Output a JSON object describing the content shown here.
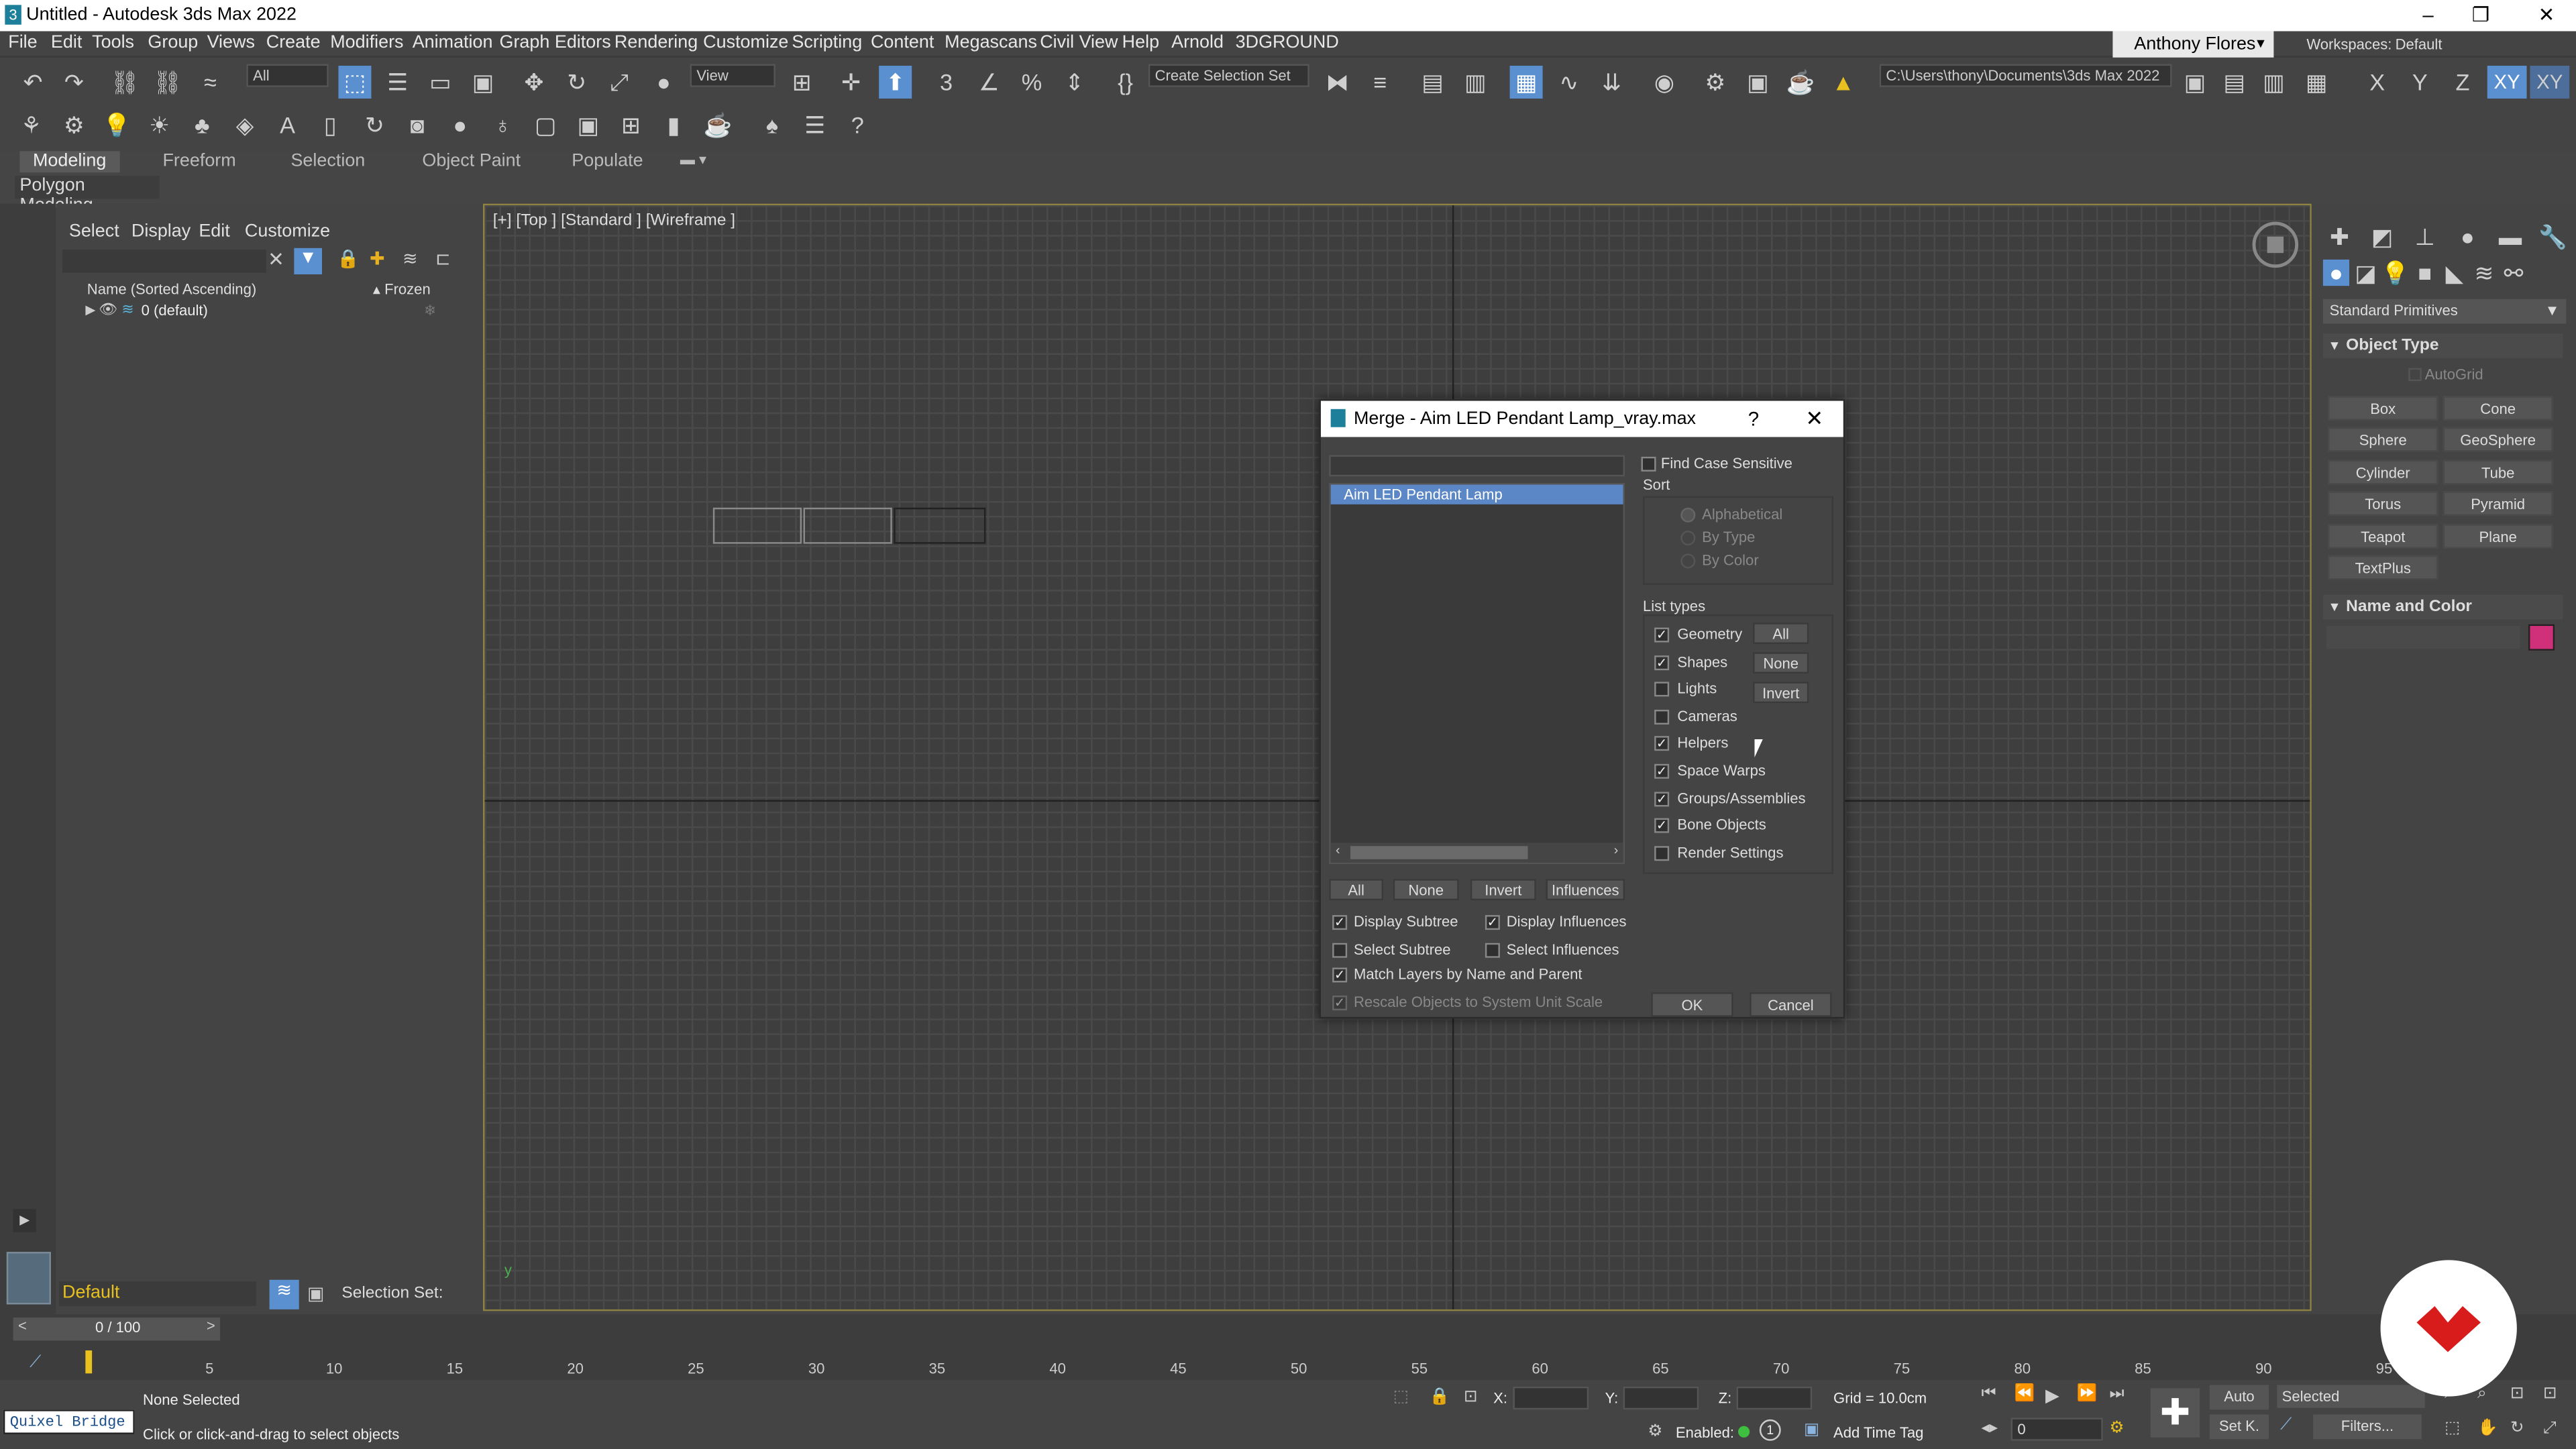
{
  "window": {
    "title": "Untitled - Autodesk 3ds Max 2022"
  },
  "menu": [
    "File",
    "Edit",
    "Tools",
    "Group",
    "Views",
    "Create",
    "Modifiers",
    "Animation",
    "Graph Editors",
    "Rendering",
    "Customize",
    "Scripting",
    "Content",
    "Megascans",
    "Civil View",
    "Help",
    "Arnold",
    "3DGROUND"
  ],
  "user": "Anthony Flores",
  "workspaces": {
    "label": "Workspaces:",
    "value": "Default"
  },
  "toolbar": {
    "filter": "All",
    "view": "View",
    "selection_set": "Create Selection Set",
    "project_path": "C:\\Users\\thony\\Documents\\3ds Max 2022",
    "axes": [
      "X",
      "Y",
      "Z",
      "XY",
      "XY"
    ]
  },
  "ribbon": {
    "tabs": [
      "Modeling",
      "Freeform",
      "Selection",
      "Object Paint",
      "Populate"
    ],
    "active_tab": "Modeling",
    "panel": "Polygon Modeling"
  },
  "scene_explorer": {
    "menu": [
      "Select",
      "Display",
      "Edit",
      "Customize"
    ],
    "column_name": "Name (Sorted Ascending)",
    "column_frozen": "▴ Frozen",
    "rows": [
      {
        "label": "0 (default)"
      }
    ],
    "layer": "Default",
    "selection_set_label": "Selection Set:"
  },
  "viewport": {
    "label": "[+] [Top ] [Standard ] [Wireframe ]"
  },
  "command_panel": {
    "category": "Standard Primitives",
    "object_type": "Object Type",
    "autogrid": "AutoGrid",
    "primitives": [
      "Box",
      "Cone",
      "Sphere",
      "GeoSphere",
      "Cylinder",
      "Tube",
      "Torus",
      "Pyramid",
      "Teapot",
      "Plane",
      "TextPlus"
    ],
    "name_and_color": "Name and Color",
    "object_color": "#d0307a"
  },
  "merge_dialog": {
    "title": "Merge - Aim LED Pendant Lamp_vray.max",
    "help": "?",
    "items": [
      "Aim LED Pendant Lamp"
    ],
    "find_case_sensitive": "Find Case Sensitive",
    "sort_label": "Sort",
    "sort_options": [
      "Alphabetical",
      "By Type",
      "By Color"
    ],
    "list_types_label": "List types",
    "list_types": [
      {
        "label": "Geometry",
        "checked": true
      },
      {
        "label": "Shapes",
        "checked": true
      },
      {
        "label": "Lights",
        "checked": false
      },
      {
        "label": "Cameras",
        "checked": false
      },
      {
        "label": "Helpers",
        "checked": true
      },
      {
        "label": "Space Warps",
        "checked": true
      },
      {
        "label": "Groups/Assemblies",
        "checked": true
      },
      {
        "label": "Bone Objects",
        "checked": true
      },
      {
        "label": "Render Settings",
        "checked": false
      }
    ],
    "type_buttons": [
      "All",
      "None",
      "Invert"
    ],
    "list_buttons": [
      "All",
      "None",
      "Invert",
      "Influences"
    ],
    "options": [
      {
        "label": "Display Subtree",
        "checked": true
      },
      {
        "label": "Display Influences",
        "checked": true
      },
      {
        "label": "Select Subtree",
        "checked": false
      },
      {
        "label": "Select Influences",
        "checked": false
      },
      {
        "label": "Match Layers by Name and Parent",
        "checked": true
      },
      {
        "label": "Rescale Objects to System Unit Scale",
        "checked": true
      }
    ],
    "ok": "OK",
    "cancel": "Cancel"
  },
  "timeline": {
    "frame": "0 / 100",
    "ticks": [
      "5",
      "10",
      "15",
      "20",
      "25",
      "30",
      "35",
      "40",
      "45",
      "50",
      "55",
      "60",
      "65",
      "70",
      "75",
      "80",
      "85",
      "90",
      "95"
    ]
  },
  "status": {
    "quixel": "Quixel Bridge",
    "selection": "None Selected",
    "prompt": "Click or click-and-drag to select objects",
    "x_label": "X:",
    "y_label": "Y:",
    "z_label": "Z:",
    "grid": "Grid = 10.0cm",
    "enabled": "Enabled:",
    "add_time_tag": "Add Time Tag",
    "auto": "Auto",
    "selected": "Selected",
    "set_key": "Set K.",
    "filters": "Filters...",
    "frame_value": "0"
  }
}
